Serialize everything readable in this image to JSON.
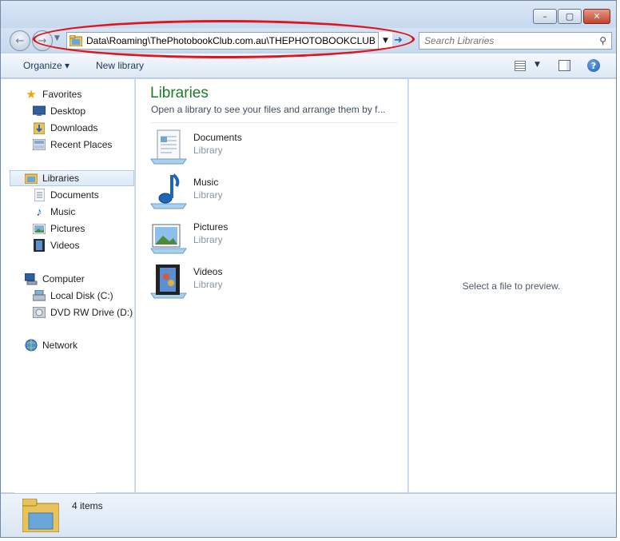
{
  "window": {
    "controls": {
      "minimize": "–",
      "maximize": "▢",
      "close": "✕"
    }
  },
  "navbar": {
    "back_icon": "←",
    "forward_icon": "→",
    "address_text": "Data\\Roaming\\ThePhotobookClub.com.au\\THEPHOTOBOOKCLUB\\",
    "address_dropdown": "▼",
    "refresh_icon": "➜",
    "search_placeholder": "Search Libraries",
    "search_icon": "⚲"
  },
  "toolbar": {
    "organize_label": "Organize ▾",
    "new_library_label": "New library",
    "views_dropdown": "▼",
    "help_label": "?"
  },
  "navpane": {
    "favorites": {
      "label": "Favorites",
      "icon": "★"
    },
    "favorites_items": [
      {
        "label": "Desktop",
        "icon": "desktop-icon"
      },
      {
        "label": "Downloads",
        "icon": "downloads-icon"
      },
      {
        "label": "Recent Places",
        "icon": "recent-places-icon"
      }
    ],
    "libraries": {
      "label": "Libraries",
      "icon": "libraries-icon"
    },
    "libraries_items": [
      {
        "label": "Documents",
        "icon": "documents-icon"
      },
      {
        "label": "Music",
        "icon": "♪"
      },
      {
        "label": "Pictures",
        "icon": "pictures-icon"
      },
      {
        "label": "Videos",
        "icon": "videos-icon"
      }
    ],
    "computer": {
      "label": "Computer",
      "icon": "computer-icon"
    },
    "computer_items": [
      {
        "label": "Local Disk (C:)",
        "icon": "disk-icon"
      },
      {
        "label": "DVD RW Drive (D:) C",
        "icon": "dvd-icon"
      }
    ],
    "network": {
      "label": "Network",
      "icon": "network-icon"
    }
  },
  "content": {
    "title": "Libraries",
    "subtitle": "Open a library to see your files and arrange them by f...",
    "items": [
      {
        "name": "Documents",
        "type": "Library",
        "icon": "documents-library-icon"
      },
      {
        "name": "Music",
        "type": "Library",
        "icon": "music-library-icon"
      },
      {
        "name": "Pictures",
        "type": "Library",
        "icon": "pictures-library-icon"
      },
      {
        "name": "Videos",
        "type": "Library",
        "icon": "videos-library-icon"
      }
    ]
  },
  "preview": {
    "text": "Select a file to preview."
  },
  "details": {
    "count": "4 items"
  },
  "colors": {
    "annotation": "#e0141c",
    "title_green": "#1e7b28",
    "link_blue": "#1e395b"
  }
}
